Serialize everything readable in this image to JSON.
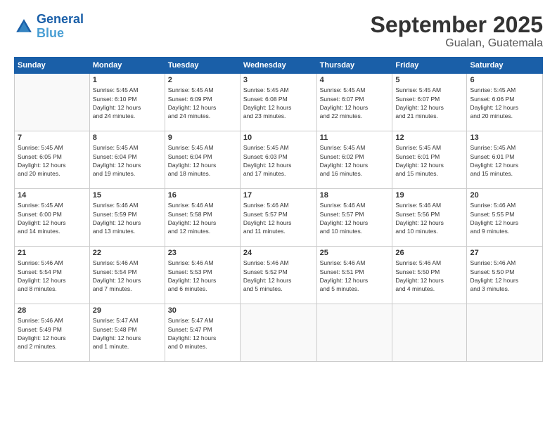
{
  "logo": {
    "line1": "General",
    "line2": "Blue"
  },
  "title": "September 2025",
  "subtitle": "Gualan, Guatemala",
  "weekdays": [
    "Sunday",
    "Monday",
    "Tuesday",
    "Wednesday",
    "Thursday",
    "Friday",
    "Saturday"
  ],
  "weeks": [
    [
      {
        "day": "",
        "info": ""
      },
      {
        "day": "1",
        "info": "Sunrise: 5:45 AM\nSunset: 6:10 PM\nDaylight: 12 hours\nand 24 minutes."
      },
      {
        "day": "2",
        "info": "Sunrise: 5:45 AM\nSunset: 6:09 PM\nDaylight: 12 hours\nand 24 minutes."
      },
      {
        "day": "3",
        "info": "Sunrise: 5:45 AM\nSunset: 6:08 PM\nDaylight: 12 hours\nand 23 minutes."
      },
      {
        "day": "4",
        "info": "Sunrise: 5:45 AM\nSunset: 6:07 PM\nDaylight: 12 hours\nand 22 minutes."
      },
      {
        "day": "5",
        "info": "Sunrise: 5:45 AM\nSunset: 6:07 PM\nDaylight: 12 hours\nand 21 minutes."
      },
      {
        "day": "6",
        "info": "Sunrise: 5:45 AM\nSunset: 6:06 PM\nDaylight: 12 hours\nand 20 minutes."
      }
    ],
    [
      {
        "day": "7",
        "info": "Sunrise: 5:45 AM\nSunset: 6:05 PM\nDaylight: 12 hours\nand 20 minutes."
      },
      {
        "day": "8",
        "info": "Sunrise: 5:45 AM\nSunset: 6:04 PM\nDaylight: 12 hours\nand 19 minutes."
      },
      {
        "day": "9",
        "info": "Sunrise: 5:45 AM\nSunset: 6:04 PM\nDaylight: 12 hours\nand 18 minutes."
      },
      {
        "day": "10",
        "info": "Sunrise: 5:45 AM\nSunset: 6:03 PM\nDaylight: 12 hours\nand 17 minutes."
      },
      {
        "day": "11",
        "info": "Sunrise: 5:45 AM\nSunset: 6:02 PM\nDaylight: 12 hours\nand 16 minutes."
      },
      {
        "day": "12",
        "info": "Sunrise: 5:45 AM\nSunset: 6:01 PM\nDaylight: 12 hours\nand 15 minutes."
      },
      {
        "day": "13",
        "info": "Sunrise: 5:45 AM\nSunset: 6:01 PM\nDaylight: 12 hours\nand 15 minutes."
      }
    ],
    [
      {
        "day": "14",
        "info": "Sunrise: 5:45 AM\nSunset: 6:00 PM\nDaylight: 12 hours\nand 14 minutes."
      },
      {
        "day": "15",
        "info": "Sunrise: 5:46 AM\nSunset: 5:59 PM\nDaylight: 12 hours\nand 13 minutes."
      },
      {
        "day": "16",
        "info": "Sunrise: 5:46 AM\nSunset: 5:58 PM\nDaylight: 12 hours\nand 12 minutes."
      },
      {
        "day": "17",
        "info": "Sunrise: 5:46 AM\nSunset: 5:57 PM\nDaylight: 12 hours\nand 11 minutes."
      },
      {
        "day": "18",
        "info": "Sunrise: 5:46 AM\nSunset: 5:57 PM\nDaylight: 12 hours\nand 10 minutes."
      },
      {
        "day": "19",
        "info": "Sunrise: 5:46 AM\nSunset: 5:56 PM\nDaylight: 12 hours\nand 10 minutes."
      },
      {
        "day": "20",
        "info": "Sunrise: 5:46 AM\nSunset: 5:55 PM\nDaylight: 12 hours\nand 9 minutes."
      }
    ],
    [
      {
        "day": "21",
        "info": "Sunrise: 5:46 AM\nSunset: 5:54 PM\nDaylight: 12 hours\nand 8 minutes."
      },
      {
        "day": "22",
        "info": "Sunrise: 5:46 AM\nSunset: 5:54 PM\nDaylight: 12 hours\nand 7 minutes."
      },
      {
        "day": "23",
        "info": "Sunrise: 5:46 AM\nSunset: 5:53 PM\nDaylight: 12 hours\nand 6 minutes."
      },
      {
        "day": "24",
        "info": "Sunrise: 5:46 AM\nSunset: 5:52 PM\nDaylight: 12 hours\nand 5 minutes."
      },
      {
        "day": "25",
        "info": "Sunrise: 5:46 AM\nSunset: 5:51 PM\nDaylight: 12 hours\nand 5 minutes."
      },
      {
        "day": "26",
        "info": "Sunrise: 5:46 AM\nSunset: 5:50 PM\nDaylight: 12 hours\nand 4 minutes."
      },
      {
        "day": "27",
        "info": "Sunrise: 5:46 AM\nSunset: 5:50 PM\nDaylight: 12 hours\nand 3 minutes."
      }
    ],
    [
      {
        "day": "28",
        "info": "Sunrise: 5:46 AM\nSunset: 5:49 PM\nDaylight: 12 hours\nand 2 minutes."
      },
      {
        "day": "29",
        "info": "Sunrise: 5:47 AM\nSunset: 5:48 PM\nDaylight: 12 hours\nand 1 minute."
      },
      {
        "day": "30",
        "info": "Sunrise: 5:47 AM\nSunset: 5:47 PM\nDaylight: 12 hours\nand 0 minutes."
      },
      {
        "day": "",
        "info": ""
      },
      {
        "day": "",
        "info": ""
      },
      {
        "day": "",
        "info": ""
      },
      {
        "day": "",
        "info": ""
      }
    ]
  ]
}
